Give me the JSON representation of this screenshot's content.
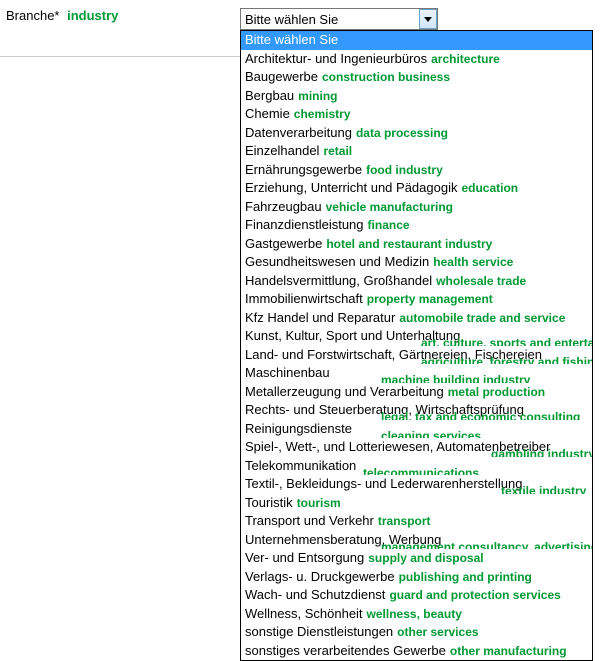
{
  "field": {
    "label": "Branche*",
    "translation": "industry"
  },
  "select": {
    "placeholder": "Bitte wählen Sie"
  },
  "options": [
    {
      "text": "Bitte wählen Sie",
      "trans": "",
      "selected": true
    },
    {
      "text": "Architektur- und Ingenieurbüros",
      "trans": "architecture"
    },
    {
      "text": "Baugewerbe",
      "trans": "construction business"
    },
    {
      "text": "Bergbau",
      "trans": "mining"
    },
    {
      "text": "Chemie",
      "trans": "chemistry"
    },
    {
      "text": "Datenverarbeitung",
      "trans": "data processing"
    },
    {
      "text": "Einzelhandel",
      "trans": "retail"
    },
    {
      "text": "Ernährungsgewerbe",
      "trans": "food industry"
    },
    {
      "text": "Erziehung, Unterricht und Pädagogik",
      "trans": "education"
    },
    {
      "text": "Fahrzeugbau",
      "trans": "vehicle manufacturing"
    },
    {
      "text": "Finanzdienstleistung",
      "trans": "finance"
    },
    {
      "text": "Gastgewerbe",
      "trans": "hotel and restaurant industry"
    },
    {
      "text": "Gesundheitswesen und Medizin",
      "trans": "health service"
    },
    {
      "text": "Handelsvermittlung, Großhandel",
      "trans": "wholesale trade"
    },
    {
      "text": "Immobilienwirtschaft",
      "trans": "property management"
    },
    {
      "text": "Kfz Handel und Reparatur",
      "trans": "automobile trade and service"
    },
    {
      "text": "Kunst, Kultur, Sport und Unterhaltung",
      "trans": "art, culture, sports and entertainment",
      "overlay": true
    },
    {
      "text": "Land- und Forstwirtschaft, Gärtnereien, Fischereien",
      "trans": "agriculture, forestry and fishing",
      "overlay": true
    },
    {
      "text": "Maschinenbau",
      "trans": "machine building industry",
      "overlay": true,
      "overlayLeft": "140px"
    },
    {
      "text": "Metallerzeugung und Verarbeitung",
      "trans": "metal production"
    },
    {
      "text": "Rechts- und Steuerberatung, Wirtschaftsprüfung",
      "trans": "legal, tax and economic consulting",
      "overlay": true,
      "overlayLeft": "140px"
    },
    {
      "text": "Reinigungsdienste",
      "trans": "cleaning services",
      "overlay": true,
      "overlayLeft": "140px"
    },
    {
      "text": "Spiel-, Wett-, und Lotteriewesen, Automatenbetreiber",
      "trans": "gambling industry",
      "overlay": true,
      "overlayLeft": "250px"
    },
    {
      "text": "Telekommunikation",
      "trans": "telecommunications",
      "overlay": true,
      "overlayLeft": "122px"
    },
    {
      "text": "Textil-, Bekleidungs- und Lederwarenherstellung",
      "trans": "textile industry",
      "overlay": true,
      "overlayLeft": "260px"
    },
    {
      "text": "Touristik",
      "trans": "tourism"
    },
    {
      "text": "Transport und Verkehr",
      "trans": "transport"
    },
    {
      "text": "Unternehmensberatung, Werbung",
      "trans": "management consultancy, advertising",
      "overlay": true,
      "overlayLeft": "140px"
    },
    {
      "text": "Ver- und Entsorgung",
      "trans": "supply and disposal"
    },
    {
      "text": "Verlags- u. Druckgewerbe",
      "trans": "publishing and printing"
    },
    {
      "text": "Wach- und Schutzdienst",
      "trans": "guard and protection services"
    },
    {
      "text": "Wellness, Schönheit",
      "trans": "wellness, beauty"
    },
    {
      "text": "sonstige Dienstleistungen",
      "trans": "other services"
    },
    {
      "text": "sonstiges verarbeitendes Gewerbe",
      "trans": "other manufacturing"
    }
  ]
}
